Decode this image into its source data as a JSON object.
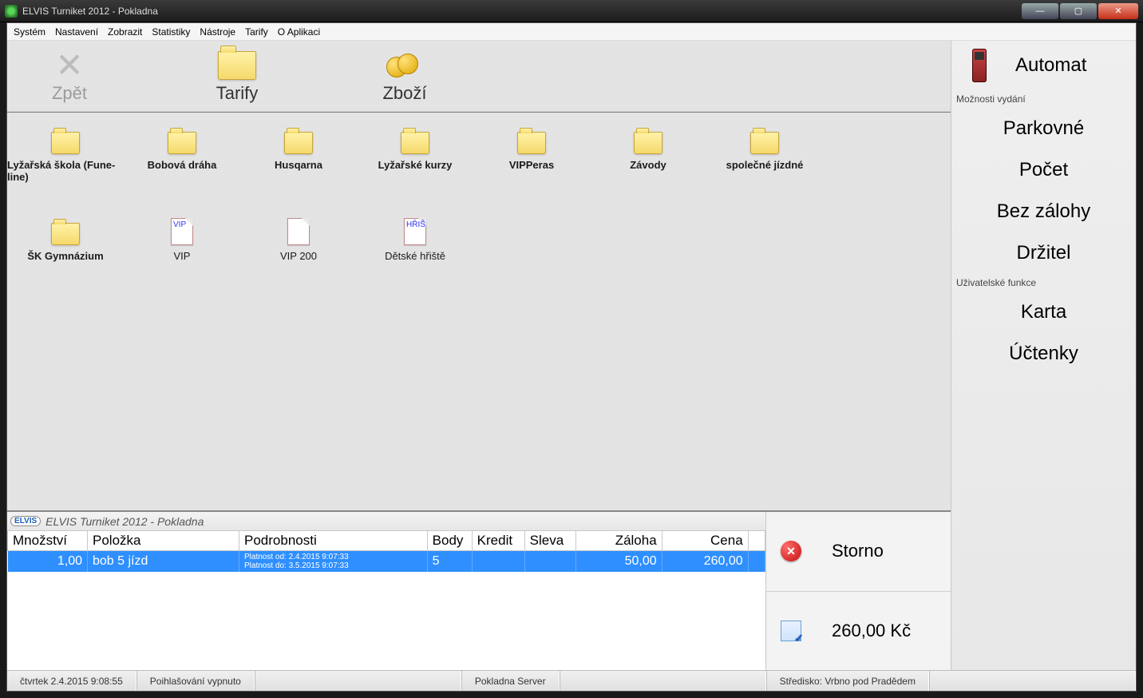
{
  "window": {
    "title": "ELVIS Turniket 2012 - Pokladna"
  },
  "menu": [
    "Systém",
    "Nastavení",
    "Zobrazit",
    "Statistiky",
    "Nástroje",
    "Tarify",
    "O Aplikaci"
  ],
  "toolbar": {
    "back": "Zpět",
    "tariffs": "Tarify",
    "goods": "Zboží"
  },
  "categories_row1": [
    {
      "label": "Lyžařská škola (Fune-line)",
      "type": "folder",
      "bold": true
    },
    {
      "label": "Bobová dráha",
      "type": "folder",
      "bold": true
    },
    {
      "label": "Husqarna",
      "type": "folder",
      "bold": true
    },
    {
      "label": "Lyžařské kurzy",
      "type": "folder",
      "bold": true
    },
    {
      "label": "VIPPeras",
      "type": "folder",
      "bold": true
    },
    {
      "label": "Závody",
      "type": "folder",
      "bold": true
    },
    {
      "label": "společné jízdné",
      "type": "folder",
      "bold": true
    }
  ],
  "categories_row2": [
    {
      "label": "ŠK Gymnázium",
      "type": "folder",
      "bold": true
    },
    {
      "label": "VIP",
      "type": "doc",
      "tag": "VIP"
    },
    {
      "label": "VIP 200",
      "type": "doc",
      "tag": ""
    },
    {
      "label": "Dětské hřiště",
      "type": "doc",
      "tag": "HŘIŠ"
    }
  ],
  "right": {
    "automat": "Automat",
    "section1": "Možnosti vydání",
    "buttons1": [
      "Parkovné",
      "Počet",
      "Bez zálohy",
      "Držitel"
    ],
    "section2": "Uživatelské funkce",
    "buttons2": [
      "Karta",
      "Účtenky"
    ]
  },
  "order": {
    "title": "ELVIS Turniket 2012 - Pokladna",
    "headers": {
      "qty": "Množství",
      "item": "Položka",
      "details": "Podrobnosti",
      "points": "Body",
      "credit": "Kredit",
      "discount": "Sleva",
      "deposit": "Záloha",
      "price": "Cena"
    },
    "rows": [
      {
        "qty": "1,00",
        "item": "bob 5 jízd",
        "detail1": "Platnost od: 2.4.2015 9:07:33",
        "detail2": "Platnost do: 3.5.2015 9:07:33",
        "points": "5",
        "credit": "",
        "discount": "",
        "deposit": "50,00",
        "price": "260,00"
      }
    ],
    "storno": "Storno",
    "total": "260,00 Kč"
  },
  "status": {
    "datetime": "čtvrtek 2.4.2015 9:08:55",
    "login": "Poihlašování vypnuto",
    "server": "Pokladna Server",
    "center": "Středisko: Vrbno pod Pradědem"
  }
}
